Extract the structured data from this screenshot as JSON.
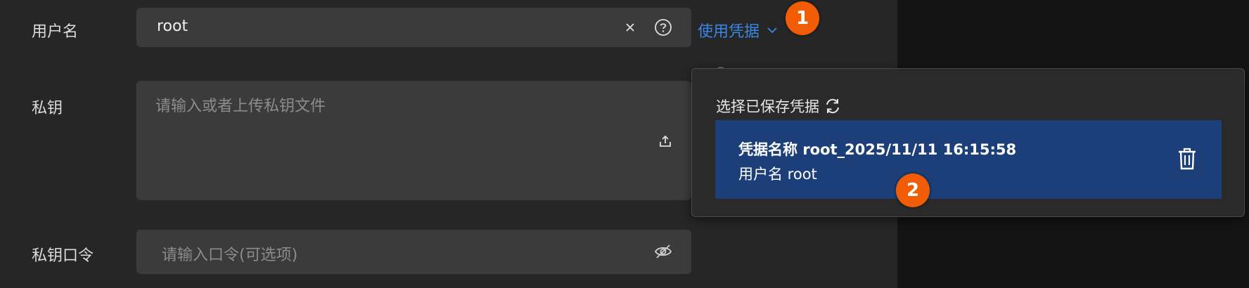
{
  "form": {
    "username_label": "用户名",
    "username_value": "root",
    "private_key_label": "私钥",
    "private_key_placeholder": "请输入或者上传私钥文件",
    "passphrase_label": "私钥口令",
    "passphrase_placeholder": "请输入口令(可选项)"
  },
  "credential_link": {
    "label": "使用凭据"
  },
  "popover": {
    "title": "选择已保存凭据",
    "items": [
      {
        "name": "凭据名称 root_2025/11/11 16:15:58",
        "user": "用户名 root"
      }
    ]
  },
  "badges": [
    "1",
    "2"
  ],
  "icons": {
    "clear": "close-icon",
    "help": "question-circle-icon",
    "upload": "upload-icon",
    "eye": "eye-invisible-icon",
    "chevron": "chevron-down-icon",
    "refresh": "refresh-icon",
    "delete": "trash-icon"
  },
  "colors": {
    "accent": "#3a86e6",
    "badge": "#f25c05",
    "selected_item": "#1c3f7a",
    "panel": "#262626",
    "field": "#3b3b3b"
  }
}
